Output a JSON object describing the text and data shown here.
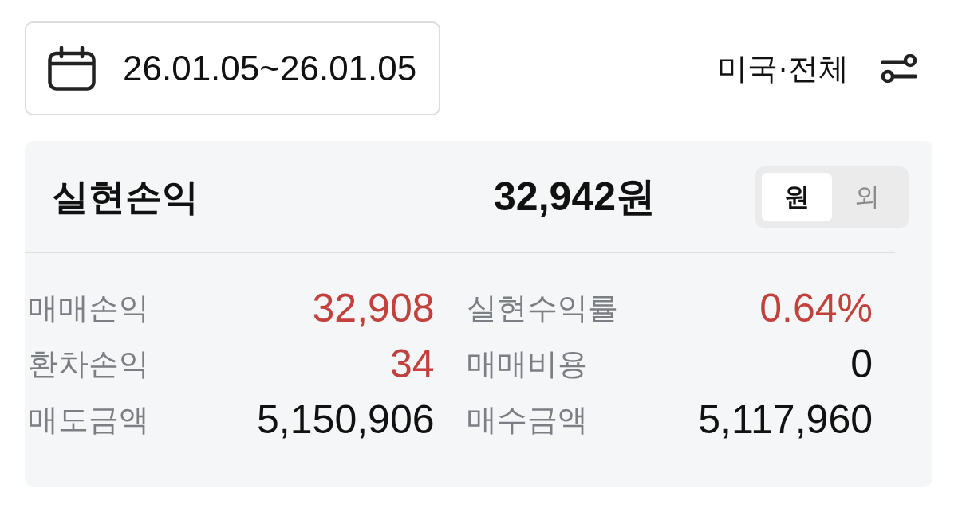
{
  "date_range": {
    "label": "26.01.05~26.01.05"
  },
  "market_filter": {
    "label": "미국·전체"
  },
  "summary": {
    "title": "실현손익",
    "amount": "32,942원",
    "currency_toggle": [
      {
        "label": "원",
        "selected": true
      },
      {
        "label": "외",
        "selected": false
      }
    ],
    "metrics": [
      {
        "label": "매매손익",
        "value": "32,908",
        "gain": true
      },
      {
        "label": "실현수익률",
        "value": "0.64%",
        "gain": true
      },
      {
        "label": "환차손익",
        "value": "34",
        "gain": true
      },
      {
        "label": "매매비용",
        "value": "0",
        "gain": false
      },
      {
        "label": "매도금액",
        "value": "5,150,906",
        "gain": false
      },
      {
        "label": "매수금액",
        "value": "5,117,960",
        "gain": false
      }
    ]
  }
}
